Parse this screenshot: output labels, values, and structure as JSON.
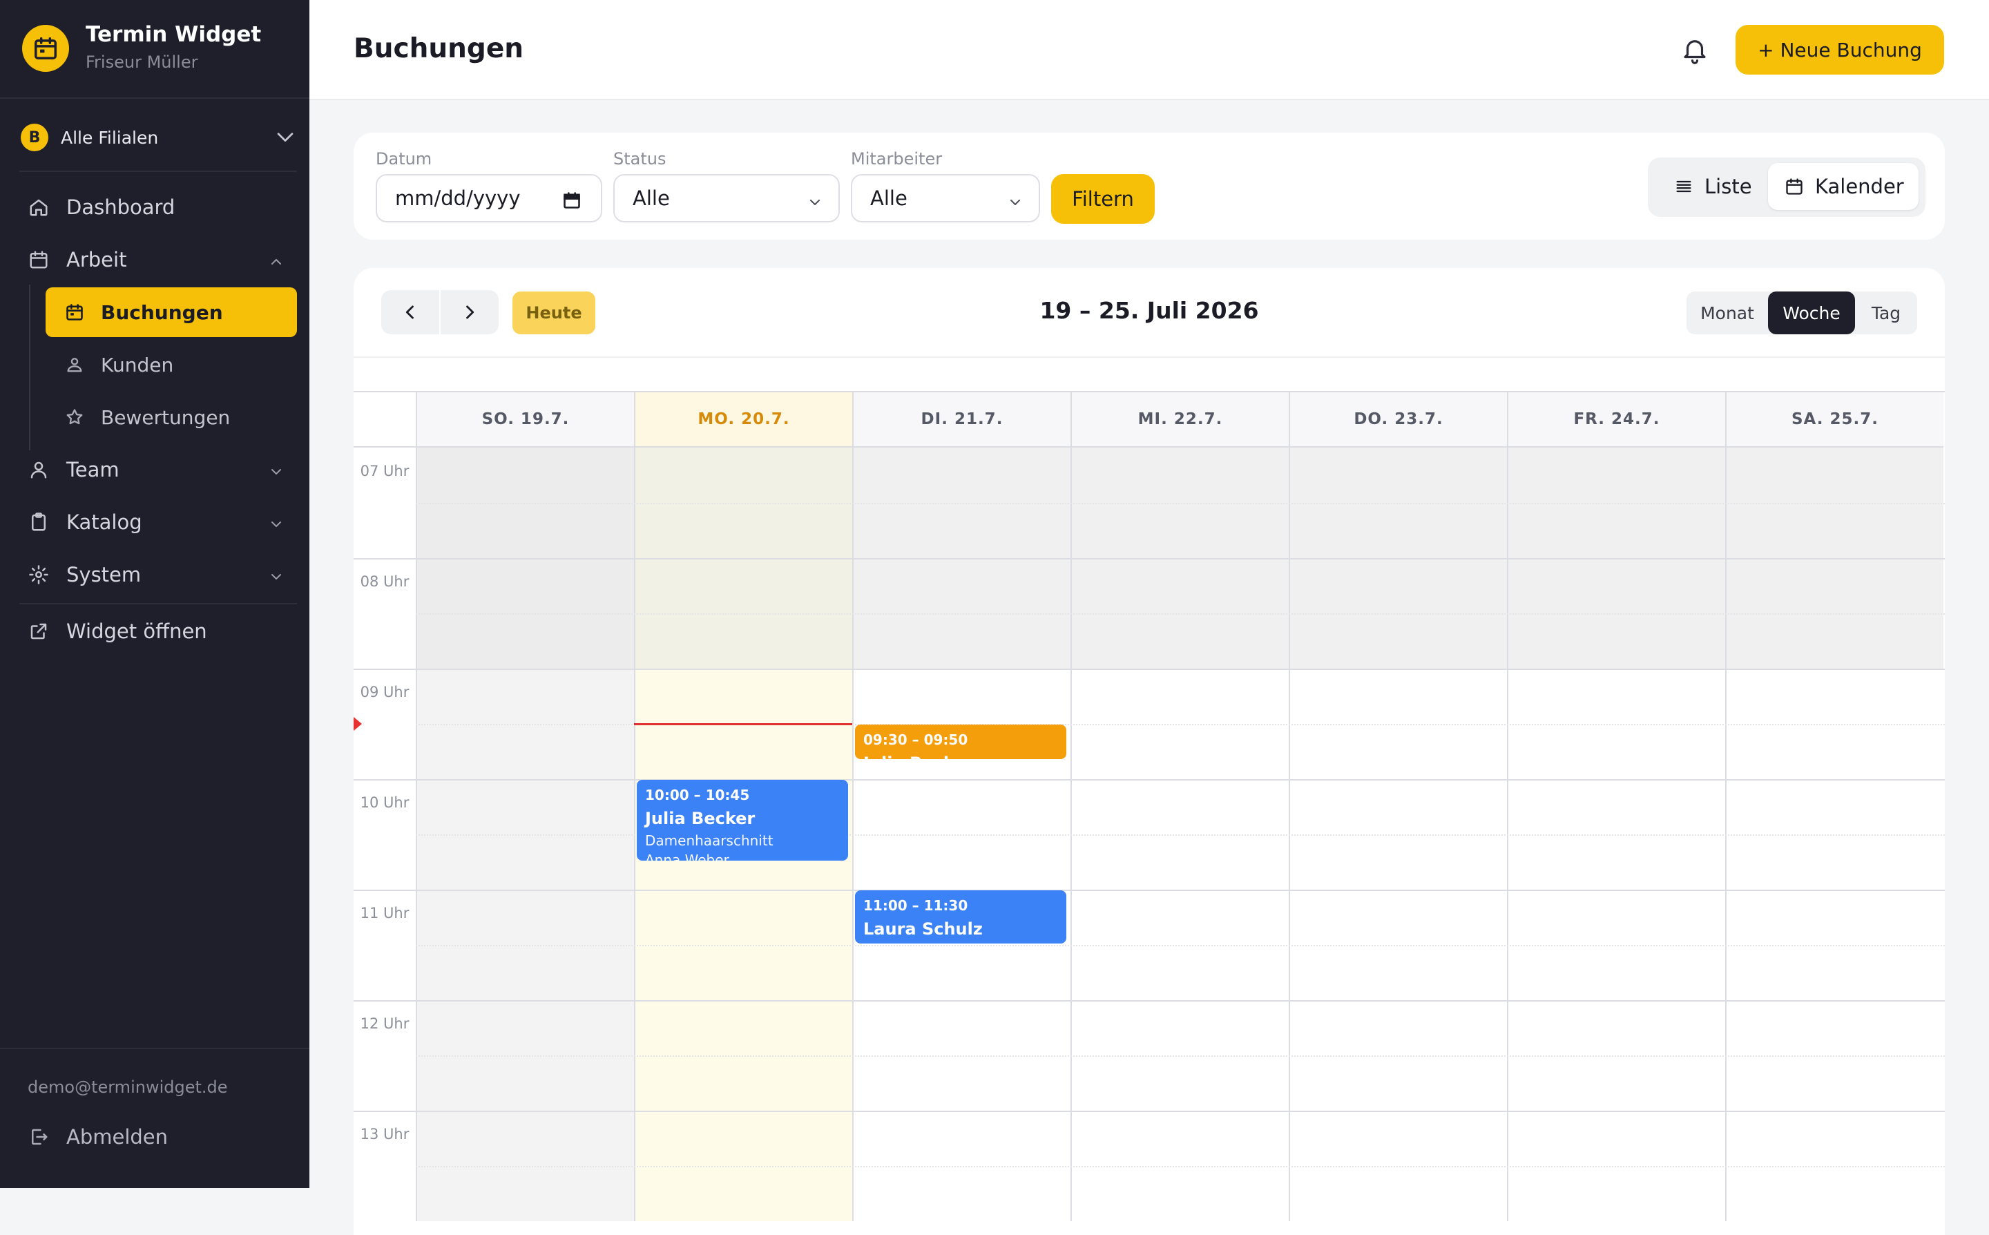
{
  "brand": {
    "title": "Termin Widget",
    "subtitle": "Friseur Müller"
  },
  "branch": {
    "badge": "B",
    "label": "Alle Filialen"
  },
  "nav": {
    "dashboard": "Dashboard",
    "arbeit": "Arbeit",
    "sub": {
      "buchungen": "Buchungen",
      "kunden": "Kunden",
      "bewertungen": "Bewertungen"
    },
    "team": "Team",
    "katalog": "Katalog",
    "system": "System",
    "widget": "Widget öffnen"
  },
  "footer": {
    "email": "demo@terminwidget.de",
    "logout": "Abmelden"
  },
  "header": {
    "title": "Buchungen",
    "new_booking": "+ Neue Buchung"
  },
  "filters": {
    "datum_label": "Datum",
    "datum_placeholder": "mm/dd/yyyy",
    "status_label": "Status",
    "status_value": "Alle",
    "mitarbeiter_label": "Mitarbeiter",
    "mitarbeiter_value": "Alle",
    "filter_button": "Filtern",
    "view_list": "Liste",
    "view_calendar": "Kalender",
    "active_view": "Kalender"
  },
  "calendar": {
    "today_button": "Heute",
    "range_title": "19 – 25. Juli 2026",
    "modes": [
      "Monat",
      "Woche",
      "Tag"
    ],
    "active_mode": "Woche",
    "days": [
      "SO. 19.7.",
      "MO. 20.7.",
      "DI. 21.7.",
      "MI. 22.7.",
      "DO. 23.7.",
      "FR. 24.7.",
      "SA. 25.7."
    ],
    "today_index": 1,
    "hours": [
      "07 Uhr",
      "08 Uhr",
      "09 Uhr",
      "10 Uhr",
      "11 Uhr",
      "12 Uhr",
      "13 Uhr"
    ],
    "now_time": "09:30",
    "events": [
      {
        "day": 2,
        "start": "09:30",
        "end": "09:50",
        "time": "09:30 – 09:50",
        "name": "Julia Becker",
        "service": "",
        "staff": "",
        "color": "orange"
      },
      {
        "day": 1,
        "start": "10:00",
        "end": "10:45",
        "time": "10:00 – 10:45",
        "name": "Julia Becker",
        "service": "Damenhaarschnitt",
        "staff": "Anna Weber",
        "color": "blue"
      },
      {
        "day": 2,
        "start": "11:00",
        "end": "11:30",
        "time": "11:00 – 11:30",
        "name": "Laura Schulz",
        "service": "",
        "staff": "",
        "color": "blue"
      }
    ]
  },
  "colors": {
    "accent": "#f5c007",
    "sidebar": "#1e1f2b",
    "event_blue": "#3b82f6",
    "event_orange": "#f59e0b",
    "now_line": "#e03131"
  }
}
